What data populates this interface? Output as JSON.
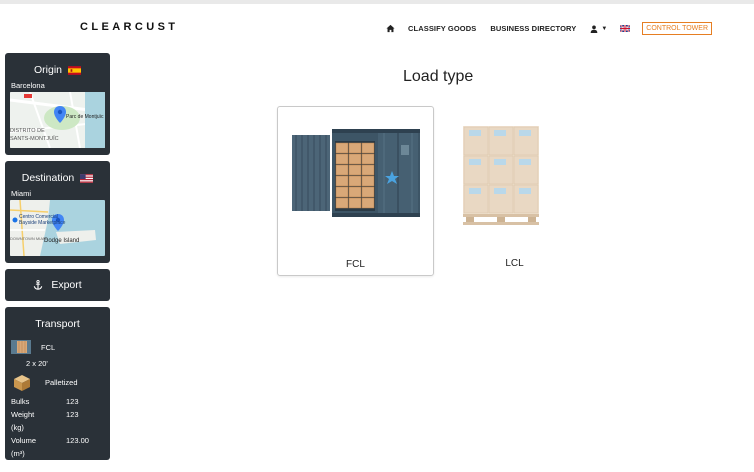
{
  "header": {
    "logo": "CLEARCUST",
    "nav": {
      "classify_goods": "CLASSIFY GOODS",
      "business_directory": "BUSINESS DIRECTORY",
      "control_tower": "CONTROL TOWER"
    }
  },
  "sidebar": {
    "origin": {
      "title": "Origin",
      "city": "Barcelona",
      "map_label_1": "Parc de Montjuïc",
      "map_label_2": "DISTRITO DE",
      "map_label_3": "SANTS-MONTJUÏC"
    },
    "destination": {
      "title": "Destination",
      "city": "Miami",
      "map_label_1": "Centro Comercial",
      "map_label_2": "Bayside Marketplace",
      "map_label_3": "Dodge Island",
      "map_label_4": "DOWNTOWN MIAMI"
    },
    "export": {
      "label": "Export"
    },
    "transport": {
      "title": "Transport",
      "mode": "FCL",
      "containers": "2 x 20'",
      "packing": "Palletized",
      "bulks_label": "Bulks",
      "bulks_value": "123",
      "weight_label": "Weight",
      "weight_value": "123",
      "weight_unit": "(kg)",
      "volume_label": "Volume",
      "volume_value": "123.00",
      "volume_unit": "(m³)"
    }
  },
  "main": {
    "title": "Load type",
    "options": [
      {
        "label": "FCL",
        "selected": true
      },
      {
        "label": "LCL",
        "selected": false
      }
    ]
  },
  "colors": {
    "sidebar_bg": "#2a3138",
    "accent_orange": "#e67e22",
    "container_teal": "#3d5566"
  }
}
